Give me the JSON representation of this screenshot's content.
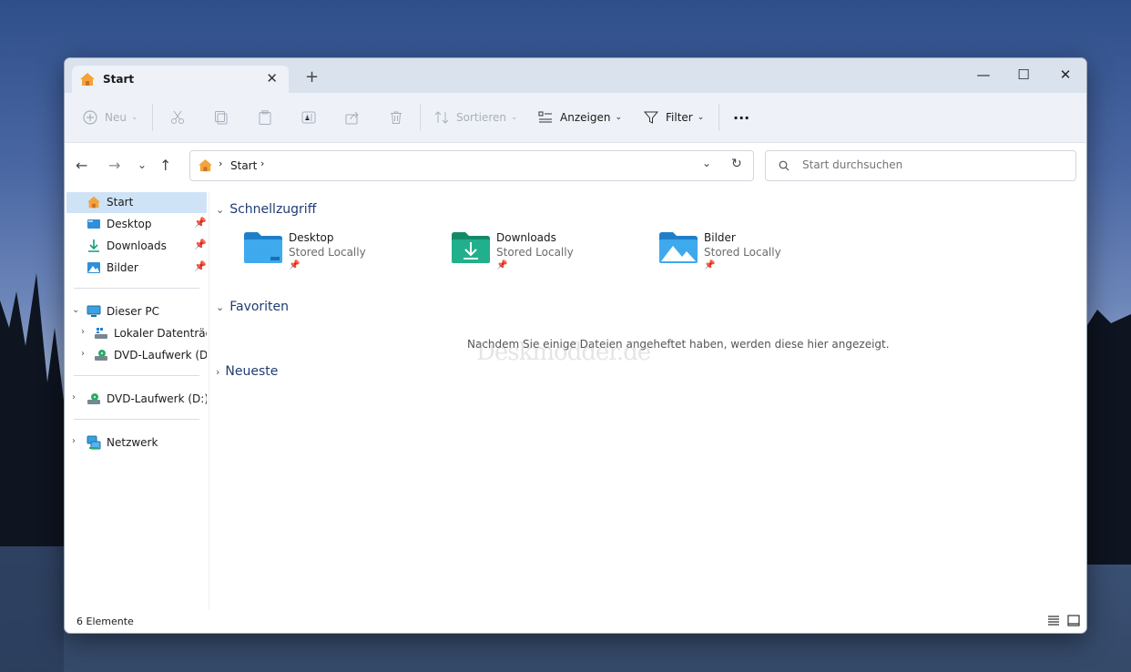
{
  "window": {
    "tab_title": "Start",
    "tab_close": "✕",
    "new_tab": "+",
    "minimize": "—",
    "maximize": "☐",
    "close": "✕"
  },
  "toolbar": {
    "new_label": "Neu",
    "sort_label": "Sortieren",
    "view_label": "Anzeigen",
    "filter_label": "Filter",
    "more_label": "···"
  },
  "nav": {
    "breadcrumb": "Start",
    "search_placeholder": "Start durchsuchen"
  },
  "sidebar": {
    "items": [
      {
        "label": "Start"
      },
      {
        "label": "Desktop"
      },
      {
        "label": "Downloads"
      },
      {
        "label": "Bilder"
      },
      {
        "label": "Dieser PC"
      },
      {
        "label": "Lokaler Datenträger"
      },
      {
        "label": "DVD-Laufwerk (D:)"
      },
      {
        "label": "DVD-Laufwerk (D:) C"
      },
      {
        "label": "Netzwerk"
      }
    ]
  },
  "content": {
    "quick_access": "Schnellzugriff",
    "favorites": "Favoriten",
    "recent": "Neueste",
    "empty_message": "Nachdem Sie einige Dateien angeheftet haben, werden diese hier angezeigt.",
    "watermark": "Deskmodder.de",
    "tiles": [
      {
        "name": "Desktop",
        "sub": "Stored Locally"
      },
      {
        "name": "Downloads",
        "sub": "Stored Locally"
      },
      {
        "name": "Bilder",
        "sub": "Stored Locally"
      }
    ]
  },
  "status": {
    "count": "6 Elemente"
  },
  "colors": {
    "accent": "#0067c0",
    "selection": "#cfe3f7",
    "section_title": "#1f3c70",
    "titlebar": "#dae2ee"
  }
}
